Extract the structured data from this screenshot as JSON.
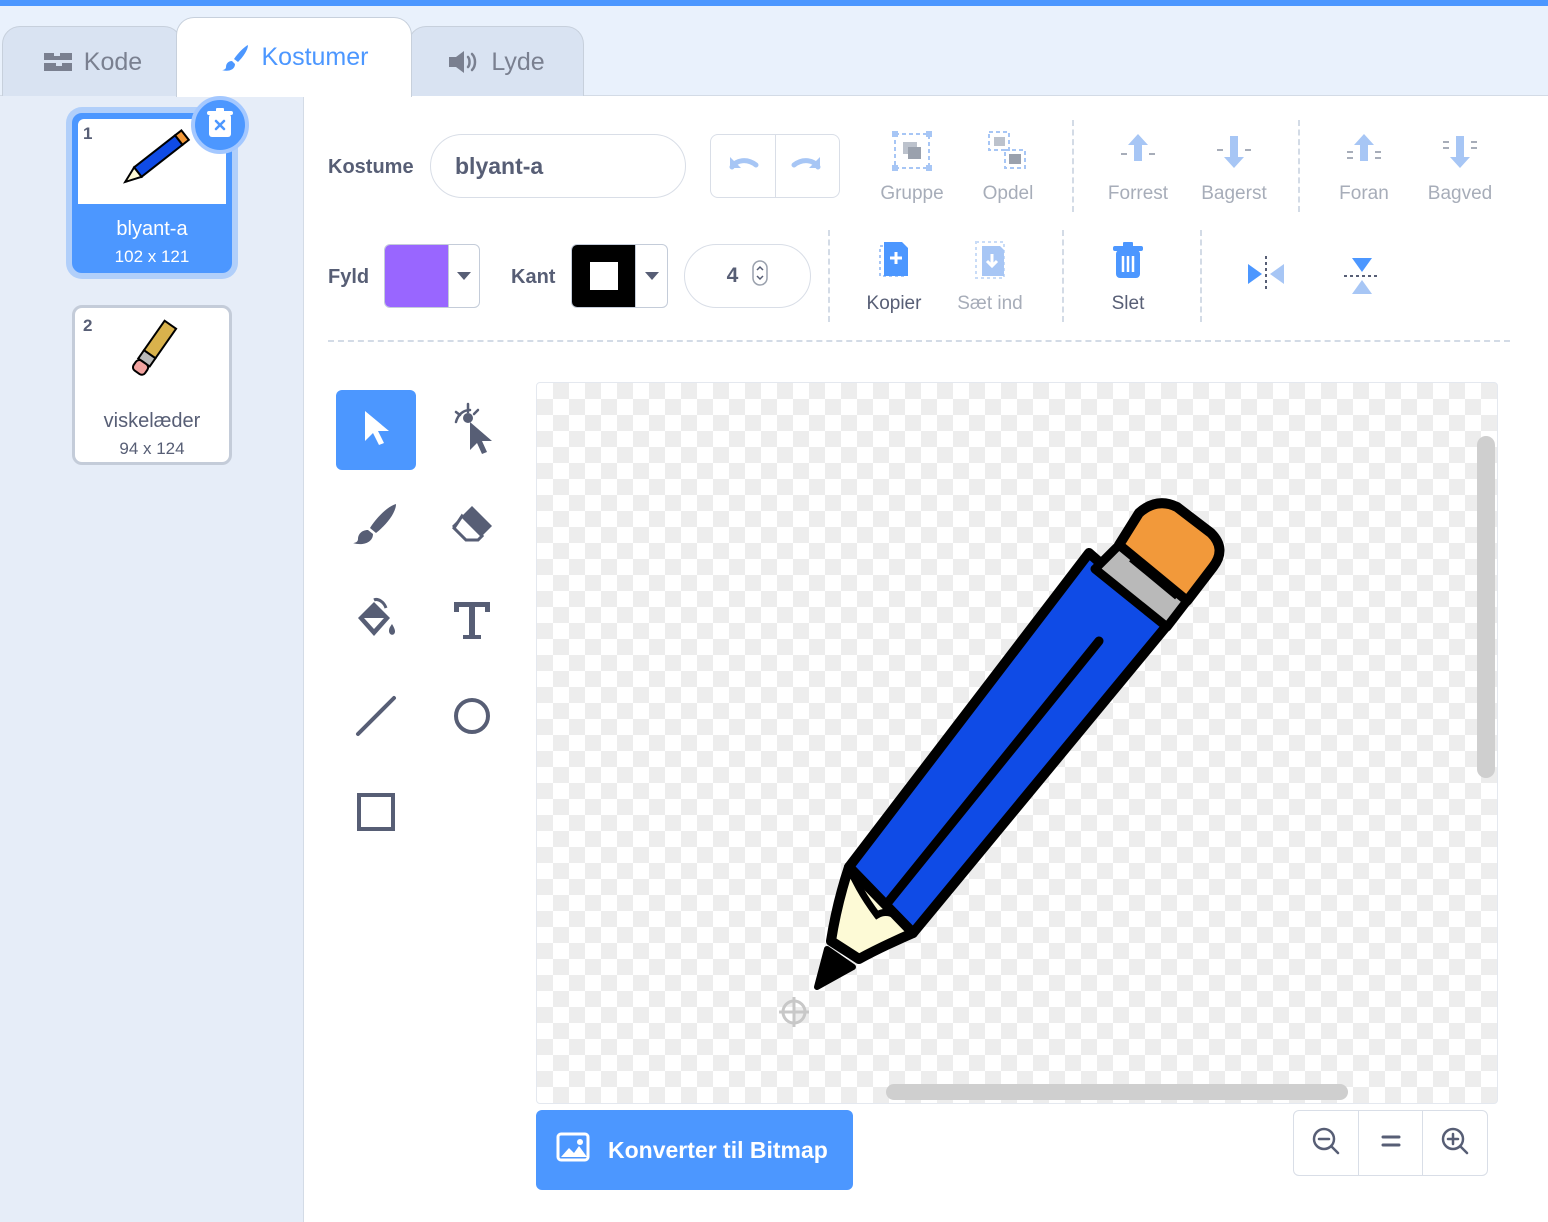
{
  "tabs": [
    {
      "label": "Kode",
      "icon": "code-blocks-icon"
    },
    {
      "label": "Kostumer",
      "icon": "paintbrush-icon",
      "active": true
    },
    {
      "label": "Lyde",
      "icon": "speaker-icon"
    }
  ],
  "costumes": [
    {
      "number": "1",
      "name": "blyant-a",
      "size": "102 x 121",
      "selected": true
    },
    {
      "number": "2",
      "name": "viskelæder",
      "size": "94 x 124",
      "selected": false
    }
  ],
  "editor": {
    "costume_label": "Kostume",
    "costume_name": "blyant-a",
    "fill_label": "Fyld",
    "fill_color": "#9966ff",
    "outline_label": "Kant",
    "outline_color": "#000000",
    "outline_width": "4"
  },
  "toolbar": {
    "group": "Gruppe",
    "ungroup": "Opdel",
    "front": "Forrest",
    "back": "Bagerst",
    "forward": "Foran",
    "backward": "Bagved",
    "copy": "Kopier",
    "paste": "Sæt ind",
    "delete": "Slet"
  },
  "tools": [
    "select",
    "reshape",
    "brush",
    "eraser",
    "fill",
    "text",
    "line",
    "circle",
    "rectangle"
  ],
  "active_tool": "select",
  "convert_button": "Konverter til Bitmap",
  "colors": {
    "accent": "#4c97ff",
    "text": "#575e75",
    "disabled": "#a7adb9",
    "pencil_body": "#0f4be6",
    "eraser": "#f2993a"
  }
}
